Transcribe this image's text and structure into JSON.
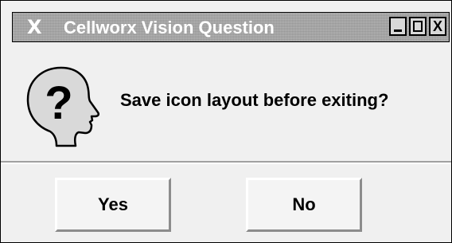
{
  "window": {
    "title_glyph": "X",
    "title": "Cellworx Vision Question",
    "controls": {
      "minimize": "minimize",
      "maximize": "maximize",
      "close": "X"
    }
  },
  "dialog": {
    "icon": "question-head-icon",
    "message": "Save icon layout before exiting?"
  },
  "buttons": {
    "yes_label": "Yes",
    "no_label": "No"
  },
  "colors": {
    "titlebar": "#a9a9a9",
    "window_bg": "#f0f0f0",
    "button_bg": "#f4f4f4"
  }
}
